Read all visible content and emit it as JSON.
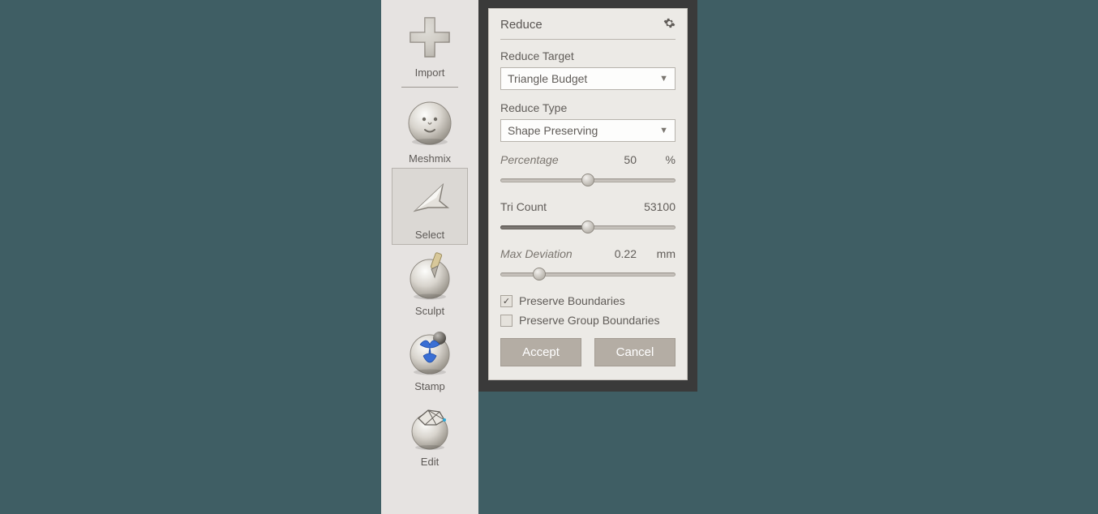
{
  "toolbar": {
    "items": [
      {
        "label": "Import"
      },
      {
        "label": "Meshmix"
      },
      {
        "label": "Select"
      },
      {
        "label": "Sculpt"
      },
      {
        "label": "Stamp"
      },
      {
        "label": "Edit"
      }
    ]
  },
  "panel": {
    "title": "Reduce",
    "reduce_target_label": "Reduce Target",
    "reduce_target_value": "Triangle Budget",
    "reduce_type_label": "Reduce Type",
    "reduce_type_value": "Shape Preserving",
    "percentage_label": "Percentage",
    "percentage_value": "50",
    "percentage_unit": "%",
    "tri_count_label": "Tri Count",
    "tri_count_value": "53100",
    "max_dev_label": "Max Deviation",
    "max_dev_value": "0.22",
    "max_dev_unit": "mm",
    "preserve_boundaries_label": "Preserve Boundaries",
    "preserve_group_boundaries_label": "Preserve Group Boundaries",
    "accept_label": "Accept",
    "cancel_label": "Cancel"
  },
  "sliders": {
    "percentage_pos": 50,
    "tri_count_pos": 50,
    "max_dev_pos": 22
  },
  "checkboxes": {
    "preserve_boundaries": true,
    "preserve_group_boundaries": false
  }
}
